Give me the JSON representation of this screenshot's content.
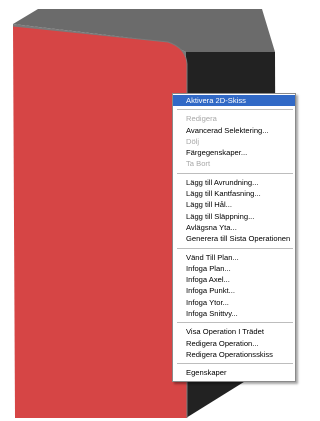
{
  "colors": {
    "body_face": "#d64545",
    "body_top": "#6b6b6b",
    "body_side": "#222222",
    "edge": "#7a7a7a",
    "menu_highlight": "#3169c6",
    "menu_disabled": "#a8a8a8"
  },
  "context_menu": {
    "items": [
      {
        "label": "Aktivera 2D-Skiss",
        "state": "highlighted"
      },
      {
        "separator": true
      },
      {
        "label": "Redigera",
        "state": "disabled"
      },
      {
        "label": "Avancerad Selektering...",
        "state": "enabled"
      },
      {
        "label": "Dölj",
        "state": "disabled"
      },
      {
        "label": "Färgegenskaper...",
        "state": "enabled"
      },
      {
        "label": "Ta Bort",
        "state": "disabled"
      },
      {
        "separator": true
      },
      {
        "label": "Lägg till Avrundning...",
        "state": "enabled"
      },
      {
        "label": "Lägg till Kantfasning...",
        "state": "enabled"
      },
      {
        "label": "Lägg till Hål...",
        "state": "enabled"
      },
      {
        "label": "Lägg till Släppning...",
        "state": "enabled"
      },
      {
        "label": "Avlägsna Yta...",
        "state": "enabled"
      },
      {
        "label": "Generera till Sista Operationen",
        "state": "enabled"
      },
      {
        "separator": true
      },
      {
        "label": "Vänd Till Plan...",
        "state": "enabled"
      },
      {
        "label": "Infoga Plan...",
        "state": "enabled"
      },
      {
        "label": "Infoga Axel...",
        "state": "enabled"
      },
      {
        "label": "Infoga Punkt...",
        "state": "enabled"
      },
      {
        "label": "Infoga Ytor...",
        "state": "enabled"
      },
      {
        "label": "Infoga Snittvy...",
        "state": "enabled"
      },
      {
        "separator": true
      },
      {
        "label": "Visa Operation I Trädet",
        "state": "enabled"
      },
      {
        "label": "Redigera Operation...",
        "state": "enabled"
      },
      {
        "label": "Redigera Operationsskiss",
        "state": "enabled"
      },
      {
        "separator": true
      },
      {
        "label": "Egenskaper",
        "state": "enabled"
      }
    ]
  }
}
